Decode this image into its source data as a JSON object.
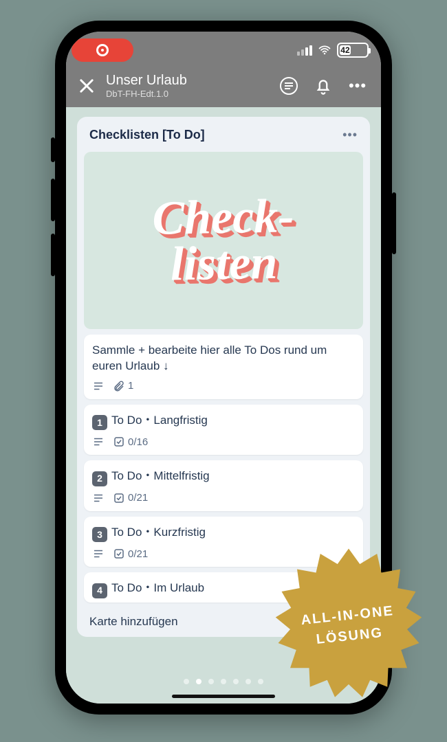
{
  "status": {
    "battery_pct": "42"
  },
  "navbar": {
    "title": "Unser Urlaub",
    "subtitle": "DbT-FH-Edt.1.0"
  },
  "list": {
    "title": "Checklisten [To Do]",
    "cover_line1": "Check-",
    "cover_line2": "listen",
    "cards": [
      {
        "title": "Sammle + bearbeite hier alle To Dos rund um euren Urlaub ↓",
        "attachments": "1"
      },
      {
        "num": "1",
        "title": "To Do・Langfristig",
        "progress": "0/16"
      },
      {
        "num": "2",
        "title": "To Do・Mittelfristig",
        "progress": "0/21"
      },
      {
        "num": "3",
        "title": "To Do・Kurzfristig",
        "progress": "0/21"
      },
      {
        "num": "4",
        "title": "To Do・Im Urlaub"
      }
    ],
    "add_label": "Karte hinzufügen"
  },
  "badge": {
    "line1": "ALL-IN-ONE",
    "line2": "LÖSUNG"
  }
}
